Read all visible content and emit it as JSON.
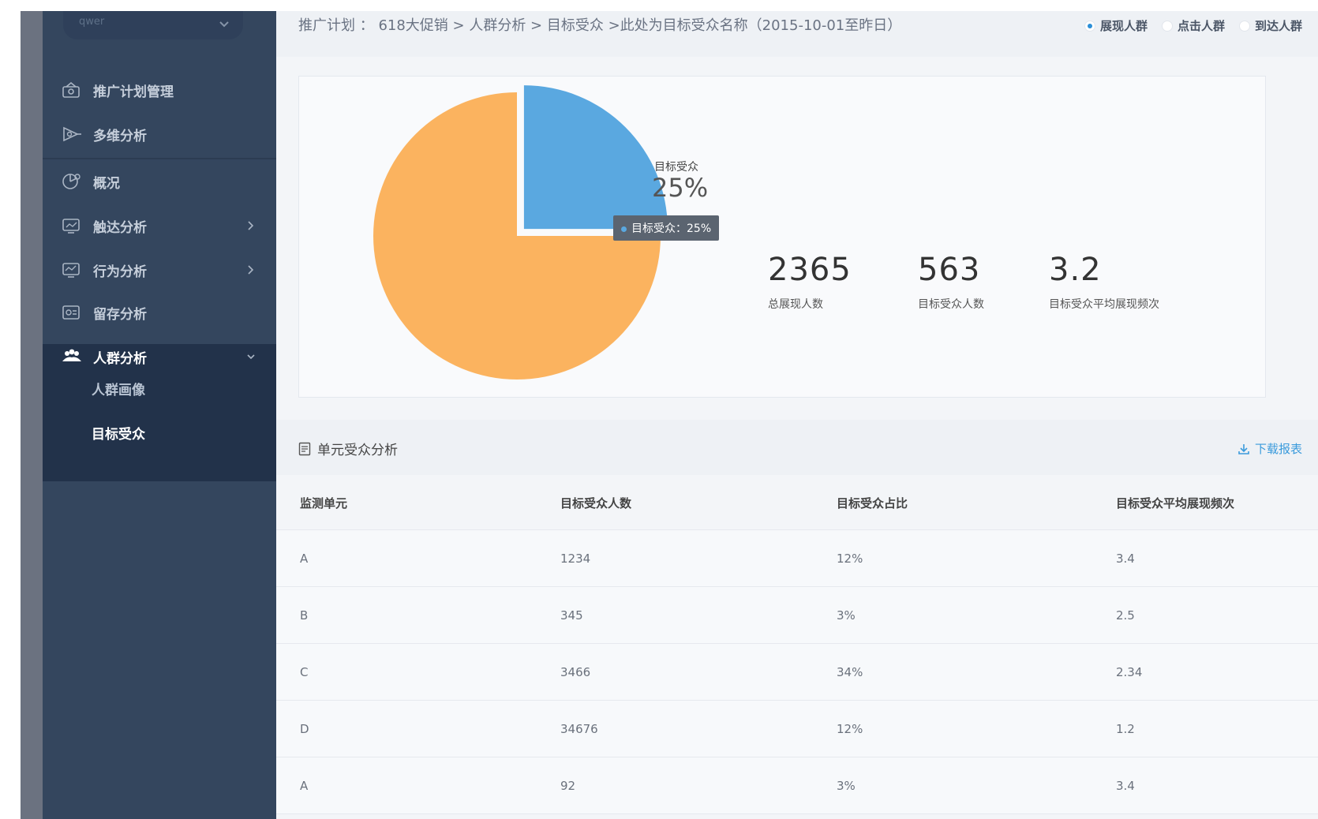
{
  "sidebar": {
    "select_value": "qwer",
    "items": [
      {
        "label": "推广计划管理",
        "icon": "campaign-icon"
      },
      {
        "label": "多维分析",
        "icon": "multidim-icon"
      },
      {
        "label": "概况",
        "icon": "overview-icon"
      },
      {
        "label": "触达分析",
        "icon": "reach-icon"
      },
      {
        "label": "行为分析",
        "icon": "behavior-icon"
      },
      {
        "label": "留存分析",
        "icon": "retention-icon"
      },
      {
        "label": "人群分析",
        "icon": "crowd-icon"
      }
    ],
    "subitems": [
      {
        "label": "人群画像"
      },
      {
        "label": "目标受众"
      }
    ]
  },
  "topbar": {
    "breadcrumb": "推广计划 ： 618大促销 > 人群分析 > 目标受众 >此处为目标受众名称（2015-10-01至昨日）",
    "radios": [
      {
        "label": "展现人群",
        "selected": true
      },
      {
        "label": "点击人群",
        "selected": false
      },
      {
        "label": "到达人群",
        "selected": false
      }
    ]
  },
  "chart_data": {
    "type": "pie",
    "slices": [
      {
        "name": "目标受众",
        "value": 25,
        "color": "#5aa8e0"
      },
      {
        "name": "",
        "value": 75,
        "color": "#fbb35f"
      }
    ],
    "label_name": "目标受众",
    "label_value": "25%",
    "tooltip": "目标受众：25%"
  },
  "stats": [
    {
      "value": "2365",
      "label": "总展现人数"
    },
    {
      "value": "563",
      "label": "目标受众人数"
    },
    {
      "value": "3.2",
      "label": "目标受众平均展现频次"
    }
  ],
  "section": {
    "title": "单元受众分析",
    "download": "下载报表"
  },
  "table": {
    "headers": [
      "监测单元",
      "目标受众人数",
      "目标受众占比",
      "目标受众平均展现频次"
    ],
    "rows": [
      [
        "A",
        "1234",
        "12%",
        "3.4"
      ],
      [
        "B",
        "345",
        "3%",
        "2.5"
      ],
      [
        "C",
        "3466",
        "34%",
        "2.34"
      ],
      [
        "D",
        "34676",
        "12%",
        "1.2"
      ],
      [
        "A",
        "92",
        "3%",
        "3.4"
      ]
    ]
  }
}
